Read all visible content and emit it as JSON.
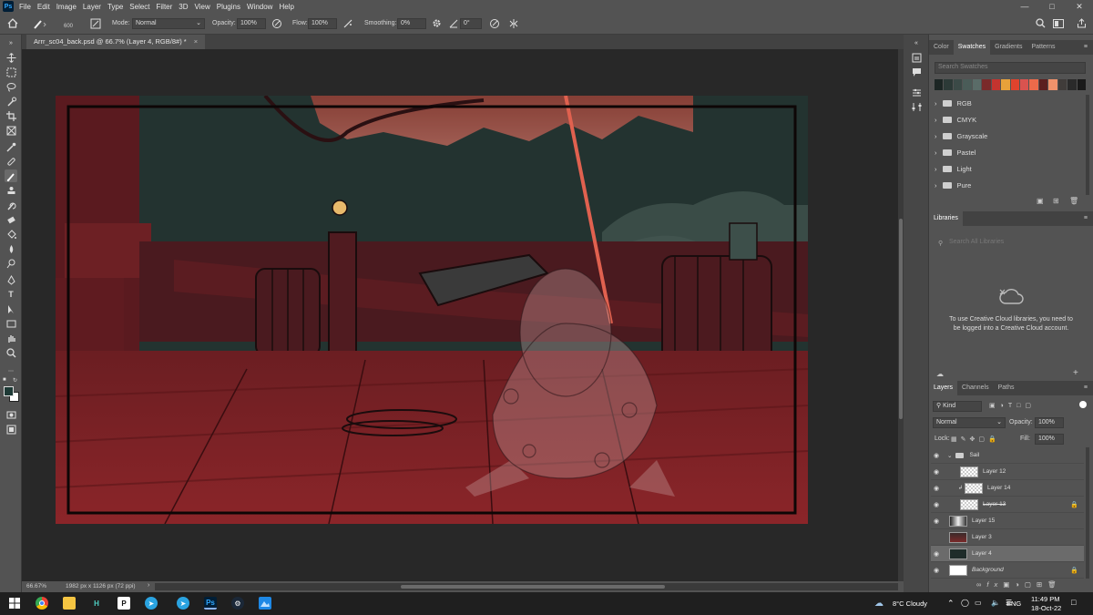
{
  "menubar": {
    "app_logo": "Ps",
    "items": [
      "File",
      "Edit",
      "Image",
      "Layer",
      "Type",
      "Select",
      "Filter",
      "3D",
      "View",
      "Plugins",
      "Window",
      "Help"
    ]
  },
  "options": {
    "brush_size": "600",
    "mode_label": "Mode:",
    "mode_value": "Normal",
    "opacity_label": "Opacity:",
    "opacity_value": "100%",
    "flow_label": "Flow:",
    "flow_value": "100%",
    "smoothing_label": "Smoothing:",
    "smoothing_value": "0%",
    "angle_value": "0°"
  },
  "document": {
    "tab_title": "Arrr_sc04_back.psd @ 66.7% (Layer 4, RGB/8#) *",
    "zoom": "66.67%",
    "dimensions": "1982 px x 1126 px (72 ppi)"
  },
  "swatches_panel": {
    "tabs": [
      "Color",
      "Swatches",
      "Gradients",
      "Patterns"
    ],
    "active_tab": "Swatches",
    "search_placeholder": "Search Swatches",
    "recent_colors": [
      "#1c2624",
      "#2c3a37",
      "#3b4a47",
      "#4a5c58",
      "#5a6c68",
      "#7a2a2a",
      "#c4342f",
      "#e8a13a",
      "#e0432d",
      "#d9534f",
      "#ec6a4a",
      "#5c1f1f",
      "#f0926b",
      "#403c3a",
      "#2a2a2a",
      "#1a1a1a"
    ],
    "groups": [
      "RGB",
      "CMYK",
      "Grayscale",
      "Pastel",
      "Light",
      "Pure"
    ]
  },
  "libraries_panel": {
    "title": "Libraries",
    "search_placeholder": "Search All Libraries",
    "message": "To use Creative Cloud libraries, you need to be logged into a Creative Cloud account."
  },
  "layers_panel": {
    "tabs": [
      "Layers",
      "Channels",
      "Paths"
    ],
    "active_tab": "Layers",
    "filter_kind": "Kind",
    "blend_mode": "Normal",
    "opacity_label": "Opacity:",
    "opacity_value": "100%",
    "lock_label": "Lock:",
    "fill_label": "Fill:",
    "fill_value": "100%",
    "layers": [
      {
        "name": "Sail",
        "visible": true,
        "type": "group"
      },
      {
        "name": "Layer 12",
        "visible": true,
        "type": "pixel"
      },
      {
        "name": "Layer 14",
        "visible": true,
        "type": "clipped"
      },
      {
        "name": "Layer 13",
        "visible": true,
        "type": "locked"
      },
      {
        "name": "Layer 15",
        "visible": true,
        "type": "pixel"
      },
      {
        "name": "Layer 3",
        "visible": false,
        "type": "pixel"
      },
      {
        "name": "Layer 4",
        "visible": true,
        "type": "selected"
      },
      {
        "name": "Background",
        "visible": true,
        "type": "background"
      }
    ]
  },
  "taskbar": {
    "weather": "8°C  Cloudy",
    "language": "ENG",
    "time": "11:49 PM",
    "date": "18-Oct-22"
  },
  "colors": {
    "foreground": "#1e3a36",
    "background": "#ffffff",
    "accent": "#31a8ff"
  }
}
